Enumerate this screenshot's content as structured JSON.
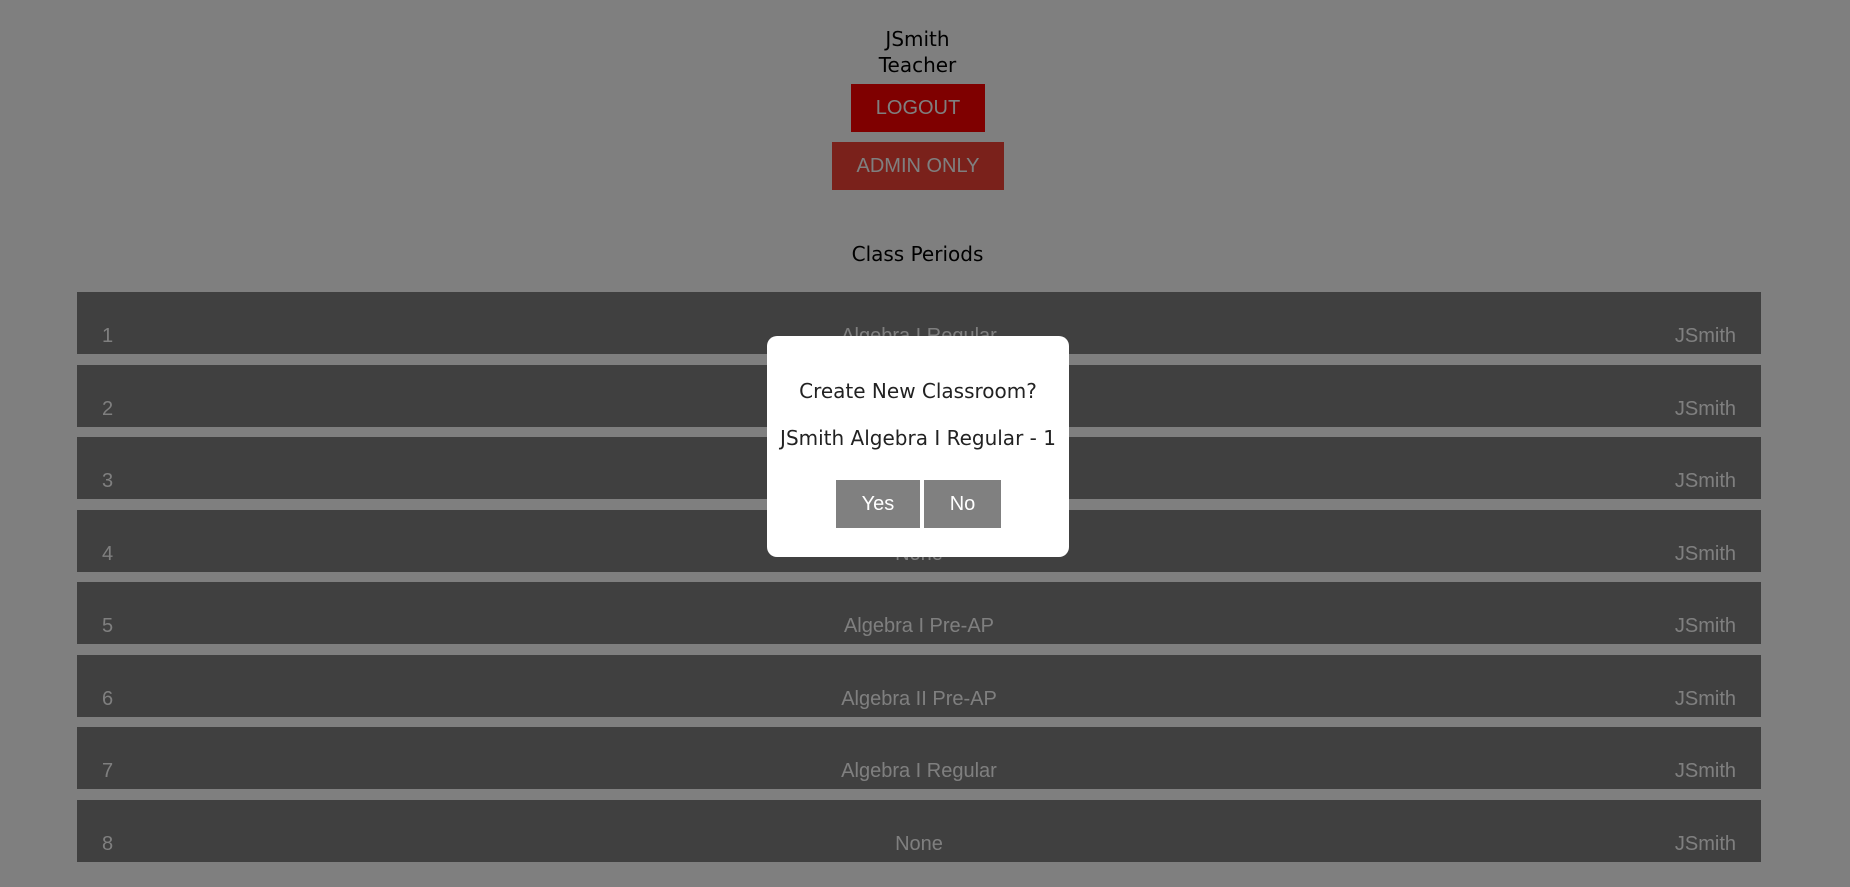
{
  "user": {
    "name": "JSmith",
    "role": "Teacher"
  },
  "buttons": {
    "logout": "LOGOUT",
    "admin_only": "ADMIN ONLY"
  },
  "section_title": "Class Periods",
  "periods": [
    {
      "number": "1",
      "course": "Algebra I Regular",
      "teacher": "JSmith"
    },
    {
      "number": "2",
      "course": "",
      "teacher": "JSmith"
    },
    {
      "number": "3",
      "course": "",
      "teacher": "JSmith"
    },
    {
      "number": "4",
      "course": "None",
      "teacher": "JSmith"
    },
    {
      "number": "5",
      "course": "Algebra I Pre-AP",
      "teacher": "JSmith"
    },
    {
      "number": "6",
      "course": "Algebra II Pre-AP",
      "teacher": "JSmith"
    },
    {
      "number": "7",
      "course": "Algebra I Regular",
      "teacher": "JSmith"
    },
    {
      "number": "8",
      "course": "None",
      "teacher": "JSmith"
    }
  ],
  "modal": {
    "title": "Create New Classroom?",
    "classroom_name": "JSmith Algebra I Regular - 1",
    "yes_label": "Yes",
    "no_label": "No"
  },
  "colors": {
    "logout_bg": "#ff0000",
    "admin_bg": "#f44336",
    "row_bg": "#808080",
    "overlay": "rgba(0,0,0,0.5)"
  }
}
